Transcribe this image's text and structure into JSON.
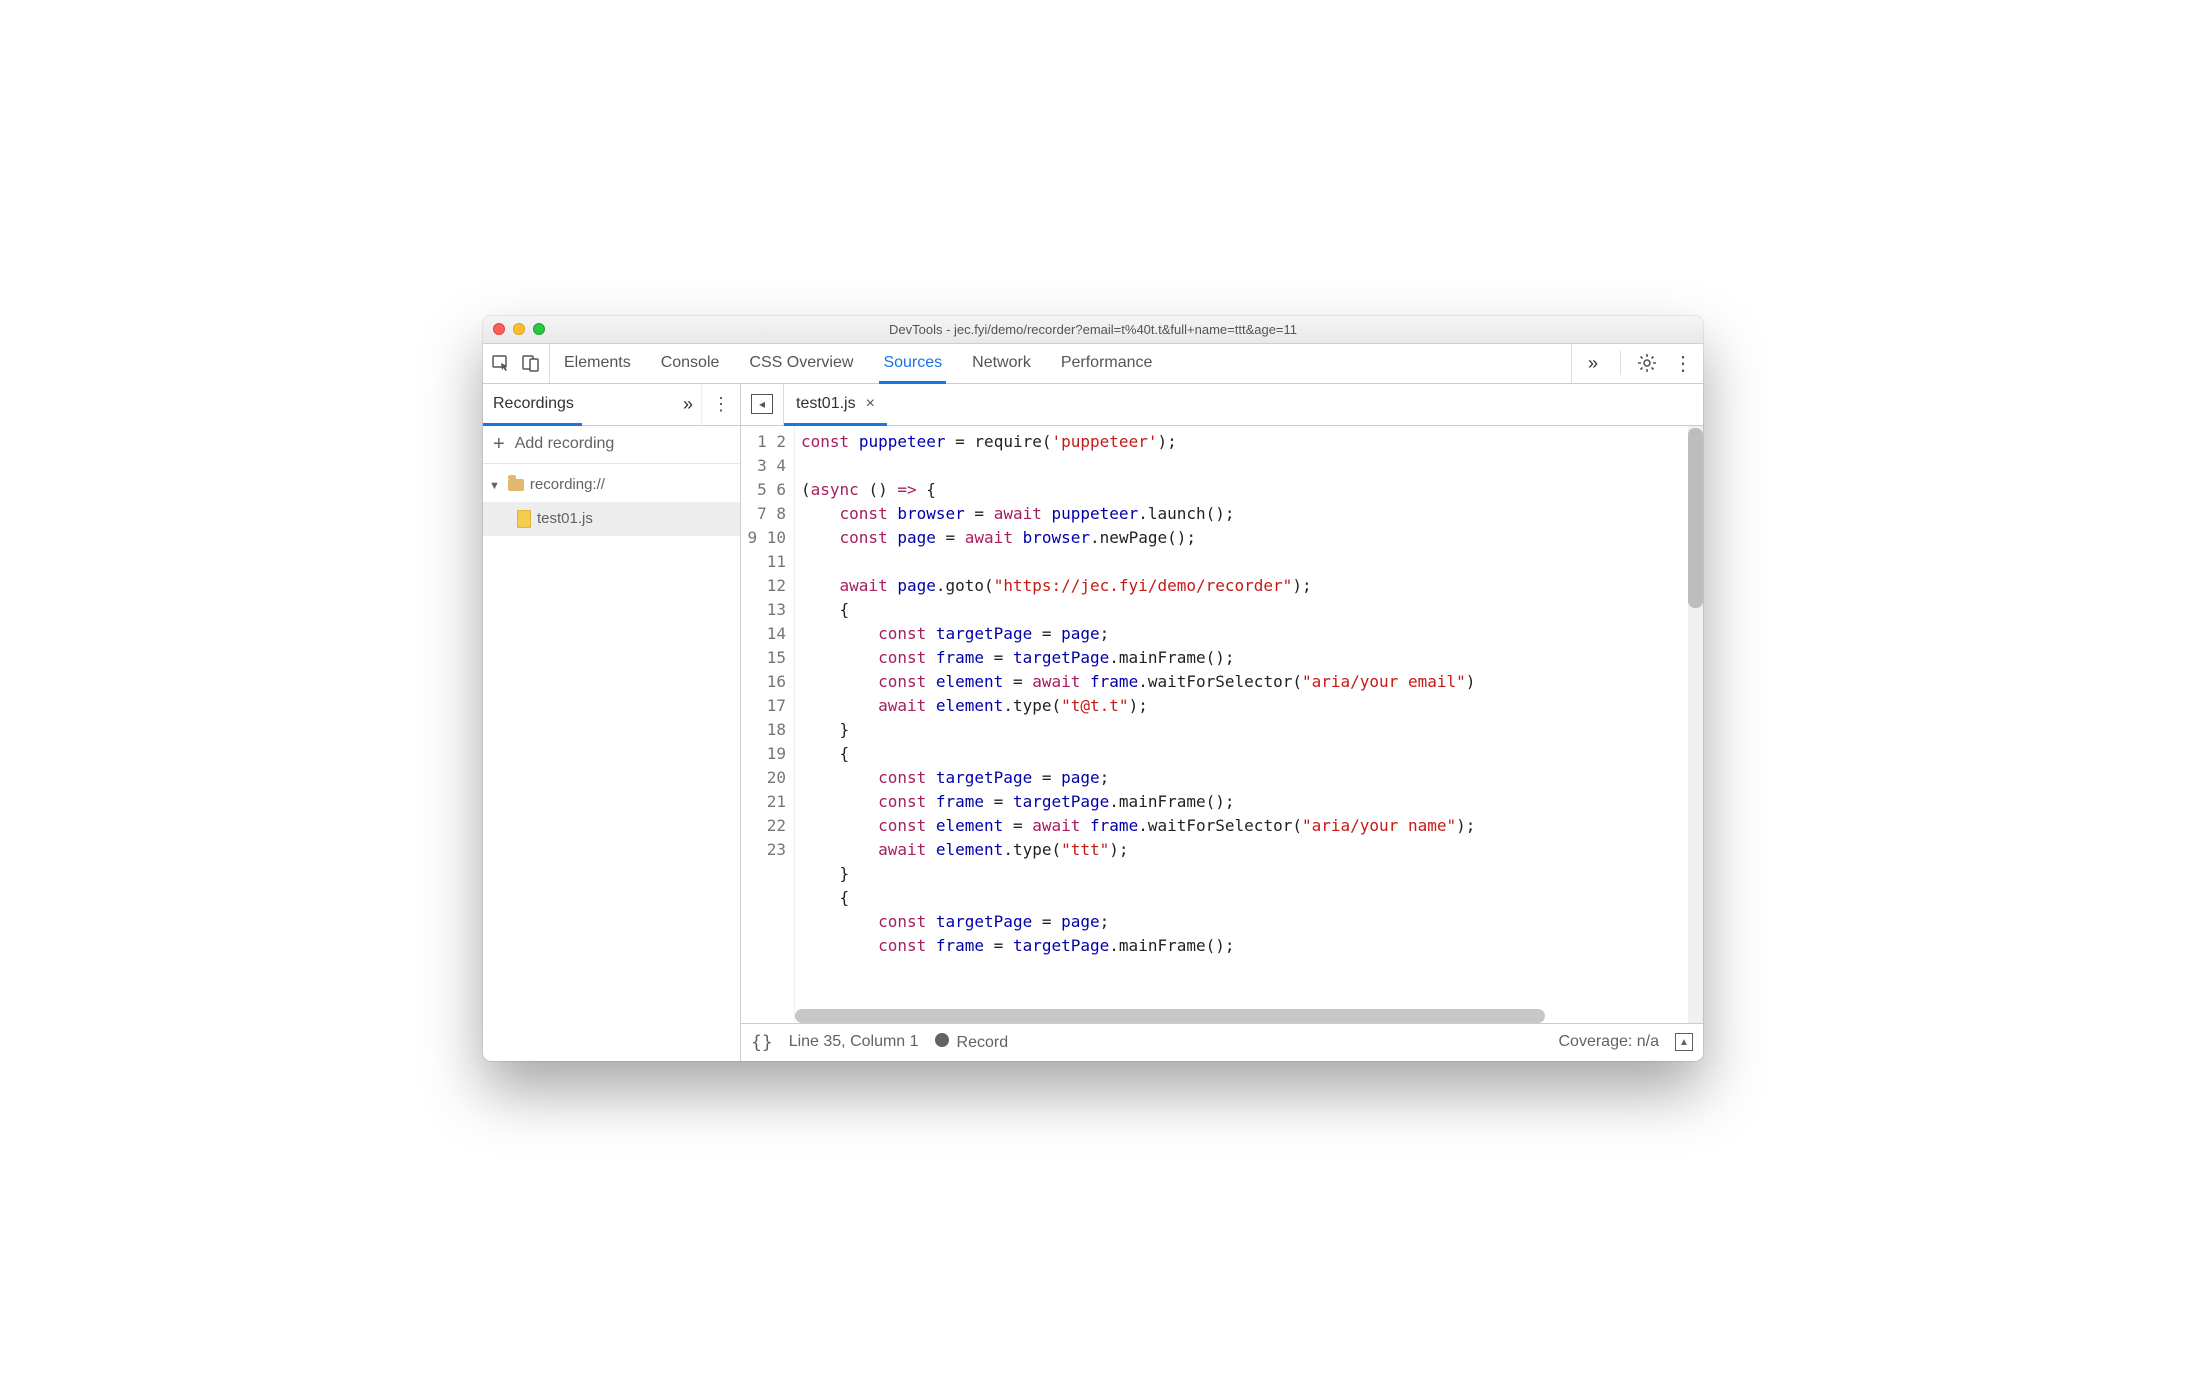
{
  "window": {
    "title": "DevTools - jec.fyi/demo/recorder?email=t%40t.t&full+name=ttt&age=11"
  },
  "panels": {
    "items": [
      "Elements",
      "Console",
      "CSS Overview",
      "Sources",
      "Network",
      "Performance"
    ],
    "active": "Sources",
    "overflow": "»"
  },
  "sidebar": {
    "tabs": {
      "items": [
        "Recordings"
      ],
      "active": "Recordings",
      "overflow": "»"
    },
    "add_label": "Add recording",
    "tree": {
      "root": {
        "label": "recording://",
        "expanded": true
      },
      "items": [
        {
          "label": "test01.js"
        }
      ]
    }
  },
  "editor": {
    "open_tab": "test01.js",
    "gutter_start": 1,
    "gutter_end": 23,
    "code_lines": [
      [
        [
          "kw",
          "const"
        ],
        [
          "op",
          " "
        ],
        [
          "id",
          "puppeteer"
        ],
        [
          "op",
          " = "
        ],
        [
          "fn",
          "require"
        ],
        [
          "op",
          "("
        ],
        [
          "str",
          "'puppeteer'"
        ],
        [
          "op",
          ");"
        ]
      ],
      [],
      [
        [
          "op",
          "("
        ],
        [
          "kw",
          "async"
        ],
        [
          "op",
          " () "
        ],
        [
          "kw",
          "=>"
        ],
        [
          "op",
          " {"
        ]
      ],
      [
        [
          "op",
          "    "
        ],
        [
          "kw",
          "const"
        ],
        [
          "op",
          " "
        ],
        [
          "id",
          "browser"
        ],
        [
          "op",
          " = "
        ],
        [
          "kw",
          "await"
        ],
        [
          "op",
          " "
        ],
        [
          "id",
          "puppeteer"
        ],
        [
          "op",
          "."
        ],
        [
          "fn",
          "launch"
        ],
        [
          "op",
          "();"
        ]
      ],
      [
        [
          "op",
          "    "
        ],
        [
          "kw",
          "const"
        ],
        [
          "op",
          " "
        ],
        [
          "id",
          "page"
        ],
        [
          "op",
          " = "
        ],
        [
          "kw",
          "await"
        ],
        [
          "op",
          " "
        ],
        [
          "id",
          "browser"
        ],
        [
          "op",
          "."
        ],
        [
          "fn",
          "newPage"
        ],
        [
          "op",
          "();"
        ]
      ],
      [],
      [
        [
          "op",
          "    "
        ],
        [
          "kw",
          "await"
        ],
        [
          "op",
          " "
        ],
        [
          "id",
          "page"
        ],
        [
          "op",
          "."
        ],
        [
          "fn",
          "goto"
        ],
        [
          "op",
          "("
        ],
        [
          "str",
          "\"https://jec.fyi/demo/recorder\""
        ],
        [
          "op",
          ");"
        ]
      ],
      [
        [
          "op",
          "    {"
        ]
      ],
      [
        [
          "op",
          "        "
        ],
        [
          "kw",
          "const"
        ],
        [
          "op",
          " "
        ],
        [
          "id",
          "targetPage"
        ],
        [
          "op",
          " = "
        ],
        [
          "id",
          "page"
        ],
        [
          "op",
          ";"
        ]
      ],
      [
        [
          "op",
          "        "
        ],
        [
          "kw",
          "const"
        ],
        [
          "op",
          " "
        ],
        [
          "id",
          "frame"
        ],
        [
          "op",
          " = "
        ],
        [
          "id",
          "targetPage"
        ],
        [
          "op",
          "."
        ],
        [
          "fn",
          "mainFrame"
        ],
        [
          "op",
          "();"
        ]
      ],
      [
        [
          "op",
          "        "
        ],
        [
          "kw",
          "const"
        ],
        [
          "op",
          " "
        ],
        [
          "id",
          "element"
        ],
        [
          "op",
          " = "
        ],
        [
          "kw",
          "await"
        ],
        [
          "op",
          " "
        ],
        [
          "id",
          "frame"
        ],
        [
          "op",
          "."
        ],
        [
          "fn",
          "waitForSelector"
        ],
        [
          "op",
          "("
        ],
        [
          "str",
          "\"aria/your email\""
        ],
        [
          "op",
          ")"
        ]
      ],
      [
        [
          "op",
          "        "
        ],
        [
          "kw",
          "await"
        ],
        [
          "op",
          " "
        ],
        [
          "id",
          "element"
        ],
        [
          "op",
          "."
        ],
        [
          "fn",
          "type"
        ],
        [
          "op",
          "("
        ],
        [
          "str",
          "\"t@t.t\""
        ],
        [
          "op",
          ");"
        ]
      ],
      [
        [
          "op",
          "    }"
        ]
      ],
      [
        [
          "op",
          "    {"
        ]
      ],
      [
        [
          "op",
          "        "
        ],
        [
          "kw",
          "const"
        ],
        [
          "op",
          " "
        ],
        [
          "id",
          "targetPage"
        ],
        [
          "op",
          " = "
        ],
        [
          "id",
          "page"
        ],
        [
          "op",
          ";"
        ]
      ],
      [
        [
          "op",
          "        "
        ],
        [
          "kw",
          "const"
        ],
        [
          "op",
          " "
        ],
        [
          "id",
          "frame"
        ],
        [
          "op",
          " = "
        ],
        [
          "id",
          "targetPage"
        ],
        [
          "op",
          "."
        ],
        [
          "fn",
          "mainFrame"
        ],
        [
          "op",
          "();"
        ]
      ],
      [
        [
          "op",
          "        "
        ],
        [
          "kw",
          "const"
        ],
        [
          "op",
          " "
        ],
        [
          "id",
          "element"
        ],
        [
          "op",
          " = "
        ],
        [
          "kw",
          "await"
        ],
        [
          "op",
          " "
        ],
        [
          "id",
          "frame"
        ],
        [
          "op",
          "."
        ],
        [
          "fn",
          "waitForSelector"
        ],
        [
          "op",
          "("
        ],
        [
          "str",
          "\"aria/your name\""
        ],
        [
          "op",
          ");"
        ]
      ],
      [
        [
          "op",
          "        "
        ],
        [
          "kw",
          "await"
        ],
        [
          "op",
          " "
        ],
        [
          "id",
          "element"
        ],
        [
          "op",
          "."
        ],
        [
          "fn",
          "type"
        ],
        [
          "op",
          "("
        ],
        [
          "str",
          "\"ttt\""
        ],
        [
          "op",
          ");"
        ]
      ],
      [
        [
          "op",
          "    }"
        ]
      ],
      [
        [
          "op",
          "    {"
        ]
      ],
      [
        [
          "op",
          "        "
        ],
        [
          "kw",
          "const"
        ],
        [
          "op",
          " "
        ],
        [
          "id",
          "targetPage"
        ],
        [
          "op",
          " = "
        ],
        [
          "id",
          "page"
        ],
        [
          "op",
          ";"
        ]
      ],
      [
        [
          "op",
          "        "
        ],
        [
          "kw",
          "const"
        ],
        [
          "op",
          " "
        ],
        [
          "id",
          "frame"
        ],
        [
          "op",
          " = "
        ],
        [
          "id",
          "targetPage"
        ],
        [
          "op",
          "."
        ],
        [
          "fn",
          "mainFrame"
        ],
        [
          "op",
          "();"
        ]
      ],
      []
    ]
  },
  "status": {
    "braces": "{}",
    "cursor": "Line 35, Column 1",
    "record": "Record",
    "coverage": "Coverage: n/a"
  }
}
